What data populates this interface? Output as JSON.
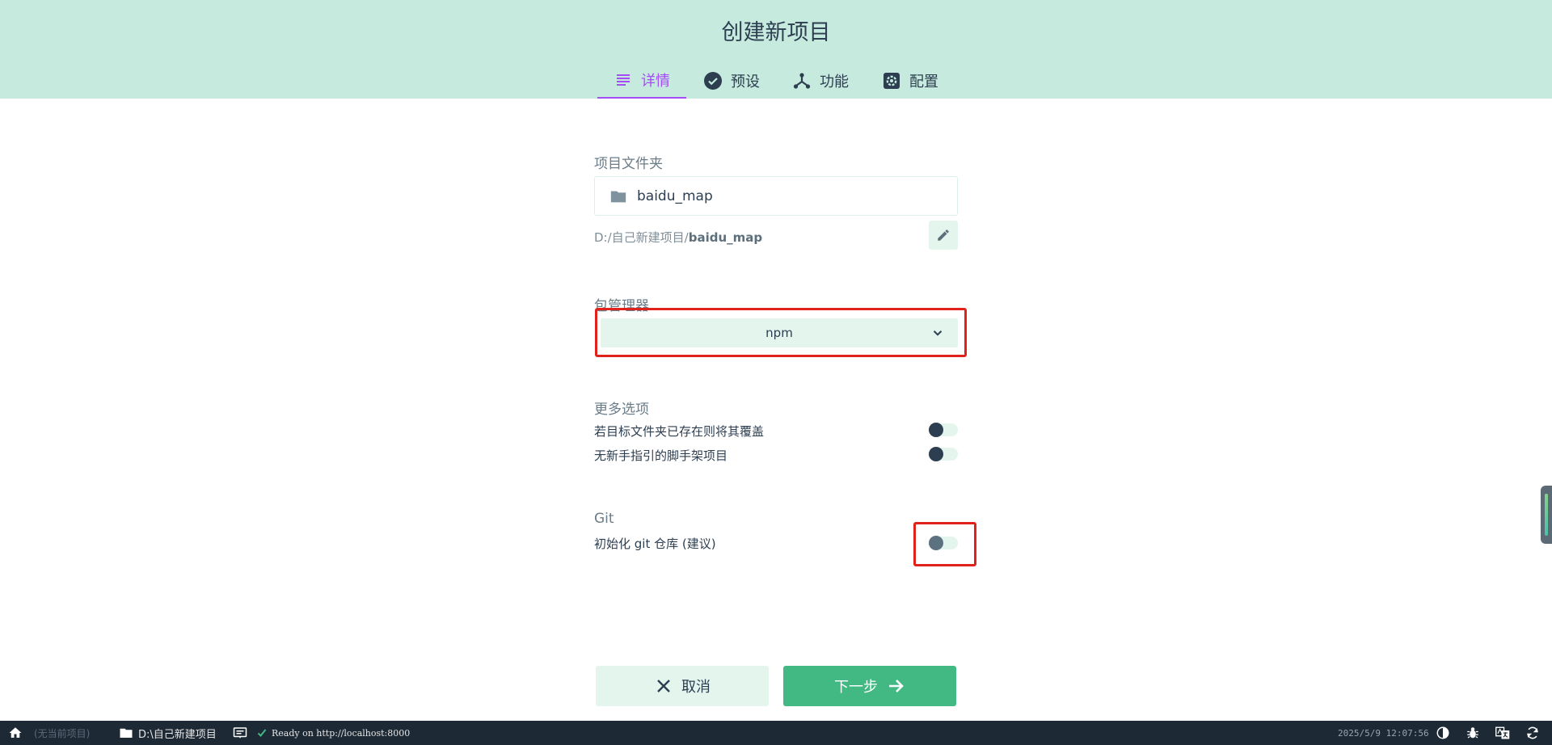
{
  "header": {
    "title": "创建新项目",
    "tabs": [
      {
        "label": "详情",
        "icon": "list-icon",
        "active": true
      },
      {
        "label": "预设",
        "icon": "check-circle-icon",
        "active": false
      },
      {
        "label": "功能",
        "icon": "fork-icon",
        "active": false
      },
      {
        "label": "配置",
        "icon": "gear-icon",
        "active": false
      }
    ]
  },
  "form": {
    "folder_label": "项目文件夹",
    "folder_value": "baidu_map",
    "path_prefix": "D:/自己新建项目/",
    "path_name": "baidu_map",
    "package_manager_label": "包管理器",
    "package_manager_value": "npm",
    "more_options_label": "更多选项",
    "options": [
      {
        "label": "若目标文件夹已存在则将其覆盖",
        "enabled": false
      },
      {
        "label": "无新手指引的脚手架项目",
        "enabled": false
      }
    ],
    "git_label": "Git",
    "git_option": {
      "label": "初始化 git 仓库 (建议)",
      "enabled": false
    }
  },
  "buttons": {
    "cancel": "取消",
    "next": "下一步"
  },
  "statusbar": {
    "no_project": "(无当前项目)",
    "folder": "D:\\自己新建项目",
    "ready": "Ready on http://localhost:8000",
    "datetime": "2025/5/9 12:07:56"
  },
  "colors": {
    "header_bg": "#c6eade",
    "accent_purple": "#a44cf6",
    "primary_green": "#42b883",
    "highlight_red": "#e0211c",
    "statusbar_bg": "#1d2935"
  }
}
